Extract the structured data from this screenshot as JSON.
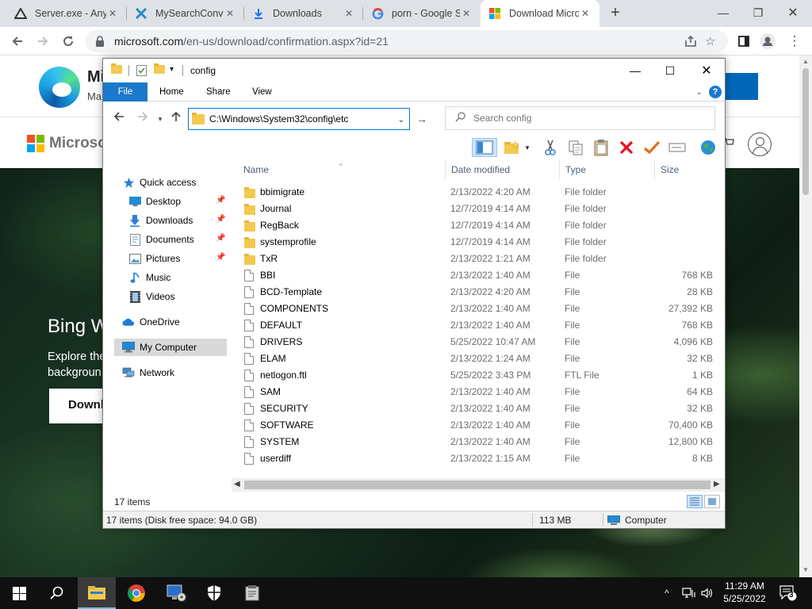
{
  "browser": {
    "tabs": [
      {
        "label": "Server.exe - Any.Run"
      },
      {
        "label": "MySearchConverter"
      },
      {
        "label": "Downloads"
      },
      {
        "label": "porn - Google Search"
      },
      {
        "label": "Download Microsoft Edge",
        "active": true
      }
    ],
    "new_tab": "+",
    "url_host": "microsoft.com",
    "url_path": "/en-us/download/confirmation.aspx?id=21"
  },
  "webpage": {
    "edge_title": "Mi",
    "edge_sub": "Ma",
    "ms_name": "Microso",
    "hero_title": "Bing W",
    "hero_line1": "Explore the",
    "hero_line2": "backgroun",
    "hero_button": "Downl",
    "colors": {
      "ms_red": "#f25022",
      "ms_green": "#7fba00",
      "ms_blue": "#00a4ef",
      "ms_yellow": "#ffb900",
      "accent": "#0067b8"
    }
  },
  "explorer": {
    "title": "config",
    "ribbon_tabs": {
      "file": "File",
      "home": "Home",
      "share": "Share",
      "view": "View"
    },
    "address": "C:\\Windows\\System32\\config\\etc",
    "search_placeholder": "Search config",
    "nav": {
      "quick_access": "Quick access",
      "desktop": "Desktop",
      "downloads": "Downloads",
      "documents": "Documents",
      "pictures": "Pictures",
      "music": "Music",
      "videos": "Videos",
      "onedrive": "OneDrive",
      "my_computer": "My Computer",
      "network": "Network"
    },
    "columns": {
      "name": "Name",
      "date": "Date modified",
      "type": "Type",
      "size": "Size"
    },
    "rows": [
      {
        "name": "bbimigrate",
        "date": "2/13/2022 4:20 AM",
        "type": "File folder",
        "size": "",
        "kind": "folder"
      },
      {
        "name": "Journal",
        "date": "12/7/2019 4:14 AM",
        "type": "File folder",
        "size": "",
        "kind": "folder"
      },
      {
        "name": "RegBack",
        "date": "12/7/2019 4:14 AM",
        "type": "File folder",
        "size": "",
        "kind": "folder"
      },
      {
        "name": "systemprofile",
        "date": "12/7/2019 4:14 AM",
        "type": "File folder",
        "size": "",
        "kind": "folder"
      },
      {
        "name": "TxR",
        "date": "2/13/2022 1:21 AM",
        "type": "File folder",
        "size": "",
        "kind": "folder"
      },
      {
        "name": "BBI",
        "date": "2/13/2022 1:40 AM",
        "type": "File",
        "size": "768 KB",
        "kind": "file"
      },
      {
        "name": "BCD-Template",
        "date": "2/13/2022 4:20 AM",
        "type": "File",
        "size": "28 KB",
        "kind": "file"
      },
      {
        "name": "COMPONENTS",
        "date": "2/13/2022 1:40 AM",
        "type": "File",
        "size": "27,392 KB",
        "kind": "file"
      },
      {
        "name": "DEFAULT",
        "date": "2/13/2022 1:40 AM",
        "type": "File",
        "size": "768 KB",
        "kind": "file"
      },
      {
        "name": "DRIVERS",
        "date": "5/25/2022 10:47 AM",
        "type": "File",
        "size": "4,096 KB",
        "kind": "file"
      },
      {
        "name": "ELAM",
        "date": "2/13/2022 1:24 AM",
        "type": "File",
        "size": "32 KB",
        "kind": "file"
      },
      {
        "name": "netlogon.ftl",
        "date": "5/25/2022 3:43 PM",
        "type": "FTL File",
        "size": "1 KB",
        "kind": "file"
      },
      {
        "name": "SAM",
        "date": "2/13/2022 1:40 AM",
        "type": "File",
        "size": "64 KB",
        "kind": "file"
      },
      {
        "name": "SECURITY",
        "date": "2/13/2022 1:40 AM",
        "type": "File",
        "size": "32 KB",
        "kind": "file"
      },
      {
        "name": "SOFTWARE",
        "date": "2/13/2022 1:40 AM",
        "type": "File",
        "size": "70,400 KB",
        "kind": "file"
      },
      {
        "name": "SYSTEM",
        "date": "2/13/2022 1:40 AM",
        "type": "File",
        "size": "12,800 KB",
        "kind": "file"
      },
      {
        "name": "userdiff",
        "date": "2/13/2022 1:15 AM",
        "type": "File",
        "size": "8 KB",
        "kind": "file"
      }
    ],
    "item_count": "17 items",
    "status_left": "17 items (Disk free space: 94.0 GB)",
    "status_size": "113 MB",
    "status_location": "Computer",
    "colors": {
      "ribbon_file": "#1979ca",
      "folder": "#f3c94f",
      "delete": "#e81123",
      "check": "#e07020",
      "selected": "#d9d9d9"
    }
  },
  "taskbar": {
    "time": "11:29 AM",
    "date": "5/25/2022",
    "notification_count": "3"
  }
}
